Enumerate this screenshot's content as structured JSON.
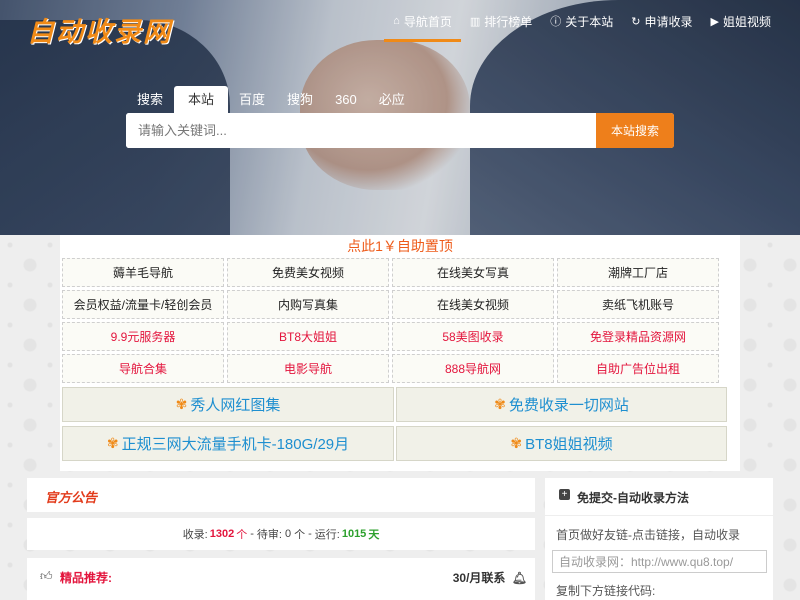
{
  "brand": {
    "logo": "自动收录网"
  },
  "nav": [
    {
      "icon": "home-icon",
      "glyph": "⌂",
      "label": "导航首页",
      "active": true
    },
    {
      "icon": "bar-chart-icon",
      "glyph": "▥",
      "label": "排行榜单"
    },
    {
      "icon": "info-icon",
      "glyph": "ⓘ",
      "label": "关于本站"
    },
    {
      "icon": "refresh-icon",
      "glyph": "↻",
      "label": "申请收录"
    },
    {
      "icon": "play-icon",
      "glyph": "▶",
      "label": "姐姐视频"
    }
  ],
  "search": {
    "tabs": [
      "搜索",
      "本站",
      "百度",
      "搜狗",
      "360",
      "必应"
    ],
    "active_tab": "本站",
    "placeholder": "请输入关键词...",
    "button": "本站搜索"
  },
  "promo": "点此1￥自助置顶",
  "links_rows": [
    [
      "薅羊毛导航",
      "免费美女视频",
      "在线美女写真",
      "潮牌工厂店"
    ],
    [
      "会员权益/流量卡/轻创会员",
      "内购写真集",
      "在线美女视频",
      "卖纸飞机账号"
    ],
    [
      "9.9元服务器",
      "BT8大姐姐",
      "58美图收录",
      "免登录精品资源网"
    ],
    [
      "导航合集",
      "电影导航",
      "888导航网",
      "自助广告位出租"
    ]
  ],
  "big_links": [
    "秀人网红图集",
    "免费收录一切网站",
    "正规三网大流量手机卡-180G/29月",
    "BT8姐姐视频"
  ],
  "notice": {
    "title": "官方公告"
  },
  "stats": {
    "collected_label": "收录:",
    "collected_value": "1302",
    "collected_unit": "个",
    "pending_label": "待审:",
    "pending_value": "0",
    "pending_unit": "个",
    "running_label": "运行:",
    "running_value": "1015",
    "running_unit": "天",
    "separator": "-"
  },
  "featured": {
    "title": "精品推荐:",
    "right": "30/月联系"
  },
  "sidebar": {
    "title": "免提交-自动收录方法",
    "desc": "首页做好友链-点击链接，自动收录",
    "input_placeholder": "自动收录网：http://www.qu8.top/",
    "copy_label": "复制下方链接代码:"
  },
  "colors": {
    "accent": "#ee7f1b",
    "link_red": "#e3153d",
    "link_blue": "#1e8fd0",
    "green": "#2ca02c"
  }
}
